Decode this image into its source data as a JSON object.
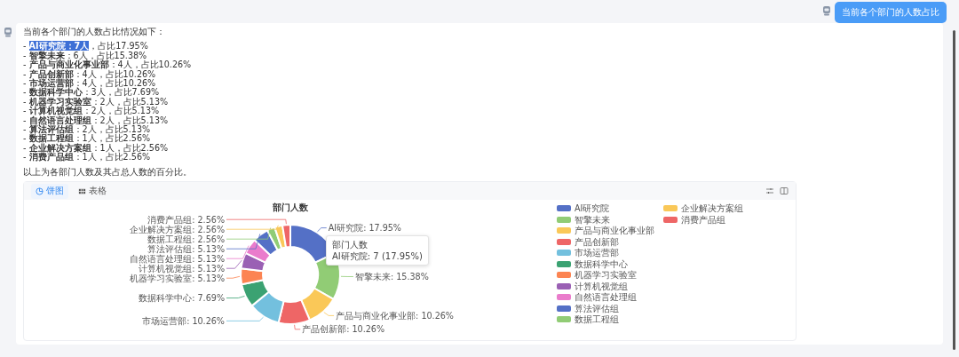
{
  "user_message": {
    "text": "当前各个部门的人数占比"
  },
  "reply": {
    "intro": "当前各个部门的人数占比情况如下：",
    "items": [
      {
        "bullet": "-",
        "bold": "AI研究院：7人",
        "rest": "，占比17.95%",
        "highlighted": true
      },
      {
        "bullet": "-",
        "bold": "智擎未来",
        "rest": "：6人，占比15.38%",
        "highlighted": false
      },
      {
        "bullet": "-",
        "bold": "产品与商业化事业部",
        "rest": "：4人，占比10.26%",
        "highlighted": false
      },
      {
        "bullet": "-",
        "bold": "产品创新部",
        "rest": "：4人，占比10.26%",
        "highlighted": false
      },
      {
        "bullet": "-",
        "bold": "市场运营部",
        "rest": "：4人，占比10.26%",
        "highlighted": false
      },
      {
        "bullet": "-",
        "bold": "数据科学中心",
        "rest": "：3人，占比7.69%",
        "highlighted": false
      },
      {
        "bullet": "-",
        "bold": "机器学习实验室",
        "rest": "：2人，占比5.13%",
        "highlighted": false
      },
      {
        "bullet": "-",
        "bold": "计算机视觉组",
        "rest": "：2人，占比5.13%",
        "highlighted": false
      },
      {
        "bullet": "-",
        "bold": "自然语言处理组",
        "rest": "：2人，占比5.13%",
        "highlighted": false
      },
      {
        "bullet": "-",
        "bold": "算法评估组",
        "rest": "：2人，占比5.13%",
        "highlighted": false
      },
      {
        "bullet": "-",
        "bold": "数据工程组",
        "rest": "：1人，占比2.56%",
        "highlighted": false
      },
      {
        "bullet": "-",
        "bold": "企业解决方案组",
        "rest": "：1人，占比2.56%",
        "highlighted": false
      },
      {
        "bullet": "-",
        "bold": "消费产品组",
        "rest": "：1人，占比2.56%",
        "highlighted": false
      }
    ],
    "outro": "以上为各部门人数及其占总人数的百分比。"
  },
  "chart_card": {
    "tabs": [
      {
        "label": "饼图",
        "kind": "pie",
        "selected": true
      },
      {
        "label": "表格",
        "kind": "table",
        "selected": false
      }
    ],
    "tooltip": {
      "text": "AI研究院: 7 (17.95%)"
    },
    "chart_data": {
      "type": "donut",
      "title": "部门人数",
      "categories": [
        "AI研究院",
        "智擎未来",
        "产品与商业化事业部",
        "产品创新部",
        "市场运营部",
        "数据科学中心",
        "机器学习实验室",
        "计算机视觉组",
        "自然语言处理组",
        "算法评估组",
        "数据工程组",
        "企业解决方案组",
        "消费产品组"
      ],
      "series": [
        {
          "name": "部门人数",
          "values": [
            17.95,
            15.38,
            10.26,
            10.26,
            10.26,
            7.69,
            5.13,
            5.13,
            5.13,
            5.13,
            2.56,
            2.56,
            2.56
          ]
        }
      ],
      "legend": true,
      "colors": [
        "#5470c6",
        "#91cc75",
        "#fac858",
        "#ee6666",
        "#73c0de",
        "#3ba272",
        "#fc8452",
        "#9a60b4",
        "#ea7ccc",
        "#5470c6",
        "#91cc75",
        "#fac858",
        "#ee6666"
      ],
      "value_labels": [
        "AI研究院: 17.95%",
        "智擎未来: 15.38%",
        "产品与商业化事业部: 10.26%",
        "产品创新部: 10.26%",
        "市场运营部: 10.26%",
        "数据科学中心: 7.69%",
        "机器学习实验室: 5.13%",
        "计算机视觉组: 5.13%",
        "自然语言处理组: 5.13%",
        "算法评估组: 5.13%",
        "数据工程组: 2.56%",
        "企业解决方案组: 2.56%",
        "消费产品组: 2.56%"
      ]
    }
  }
}
